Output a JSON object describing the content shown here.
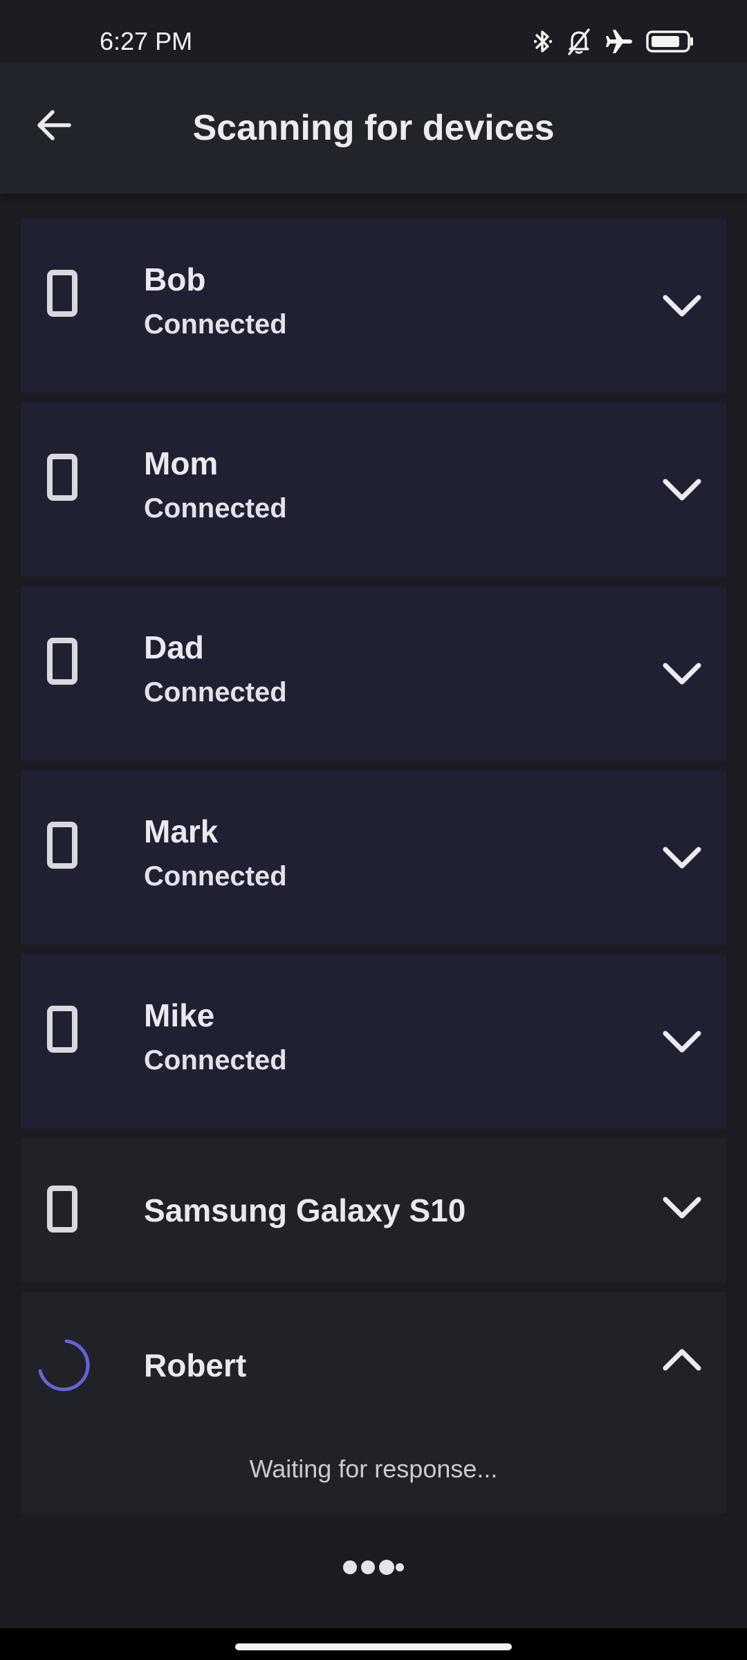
{
  "status_bar": {
    "time": "6:27 PM",
    "icons": [
      "bluetooth-icon",
      "notifications-off-icon",
      "airplane-mode-icon",
      "battery-icon"
    ]
  },
  "app_bar": {
    "title": "Scanning for devices",
    "back_icon": "arrow-back-icon"
  },
  "devices": [
    {
      "name": "Bob",
      "status": "Connected",
      "icon": "phone-icon",
      "chevron": "chevron-down-icon"
    },
    {
      "name": "Mom",
      "status": "Connected",
      "icon": "phone-icon",
      "chevron": "chevron-down-icon"
    },
    {
      "name": "Dad",
      "status": "Connected",
      "icon": "phone-icon",
      "chevron": "chevron-down-icon"
    },
    {
      "name": "Mark",
      "status": "Connected",
      "icon": "phone-icon",
      "chevron": "chevron-down-icon"
    },
    {
      "name": "Mike",
      "status": "Connected",
      "icon": "phone-icon",
      "chevron": "chevron-down-icon"
    },
    {
      "name": "Samsung Galaxy S10",
      "icon": "phone-icon",
      "chevron": "chevron-down-icon"
    },
    {
      "name": "Robert",
      "icon": "loading-spinner-icon",
      "chevron": "chevron-up-icon",
      "detail": "Waiting for response..."
    }
  ],
  "pager": {
    "dots": 3,
    "active_index": 2
  },
  "colors": {
    "background": "#1a1c22",
    "app_bar": "#22242b",
    "connected_card": "#1f2133",
    "available_card": "#202228",
    "spinner": "#6264d6",
    "text": "#e9e9ee"
  }
}
